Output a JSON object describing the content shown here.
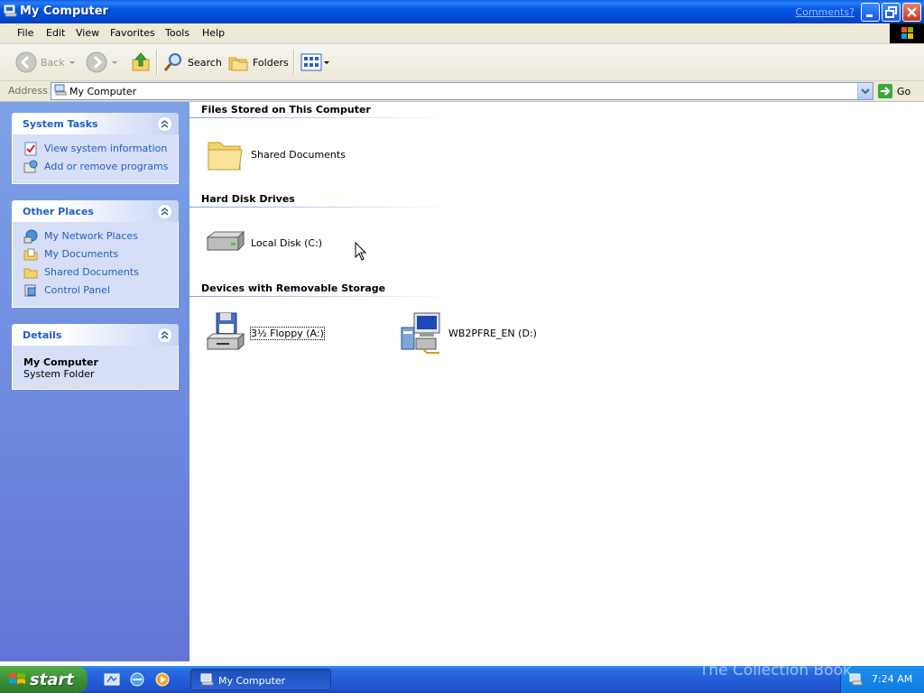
{
  "window": {
    "title": "My Computer",
    "comments_link": "Comments?"
  },
  "menu": [
    "File",
    "Edit",
    "View",
    "Favorites",
    "Tools",
    "Help"
  ],
  "toolbar": {
    "back_label": "Back",
    "search_label": "Search",
    "folders_label": "Folders"
  },
  "address": {
    "label": "Address",
    "value": "My Computer",
    "go_label": "Go"
  },
  "left": {
    "system_tasks": {
      "title": "System Tasks",
      "items": [
        "View system information",
        "Add or remove programs"
      ]
    },
    "other_places": {
      "title": "Other Places",
      "items": [
        "My Network Places",
        "My Documents",
        "Shared Documents",
        "Control Panel"
      ]
    },
    "details": {
      "title": "Details",
      "name": "My Computer",
      "type": "System Folder"
    }
  },
  "content": {
    "groups": [
      {
        "title": "Files Stored on This Computer",
        "items": [
          "Shared Documents"
        ]
      },
      {
        "title": "Hard Disk Drives",
        "items": [
          "Local Disk (C:)"
        ]
      },
      {
        "title": "Devices with Removable Storage",
        "items": [
          "3½ Floppy (A:)",
          "WB2PFRE_EN (D:)"
        ]
      }
    ]
  },
  "taskbar": {
    "start_label": "start",
    "task_label": "My Computer",
    "clock": "7:24 AM",
    "watermark": "The Collection Book"
  }
}
